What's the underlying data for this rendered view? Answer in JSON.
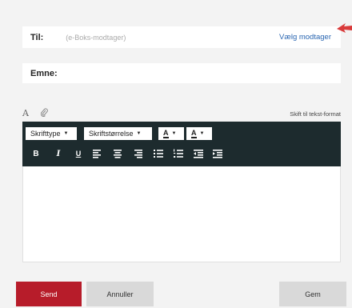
{
  "to": {
    "label": "Til:",
    "placeholder": "(e-Boks-modtager)",
    "choose_label": "Vælg modtager"
  },
  "subject": {
    "label": "Emne:"
  },
  "format_bar": {
    "switch_label": "Skift til tekst-format"
  },
  "toolbar": {
    "font_type_label": "Skrifttype",
    "font_size_label": "Skriftstørrelse",
    "text_color_letter": "A",
    "bg_color_letter": "A",
    "bold": "B",
    "italic": "I",
    "underline": "U"
  },
  "actions": {
    "send_label": "Send",
    "cancel_label": "Annuller",
    "save_label": "Gem"
  },
  "colors": {
    "toolbar_bg": "#1d2b2e",
    "send_bg": "#b71c2a",
    "link": "#2a66b1",
    "arrow": "#d93a3a"
  }
}
